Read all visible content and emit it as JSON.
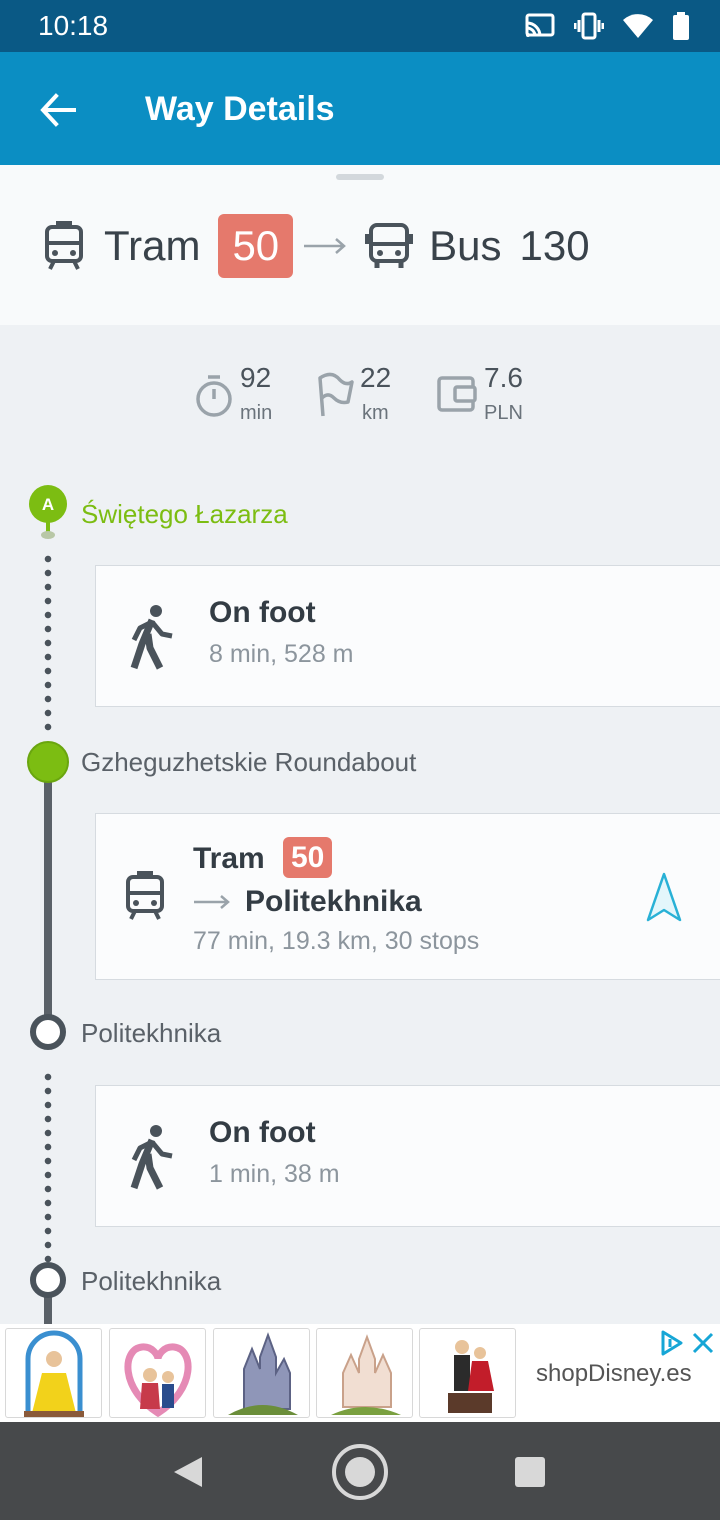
{
  "status_bar": {
    "time": "10:18"
  },
  "app_bar": {
    "title": "Way Details"
  },
  "summary": {
    "first_mode": "Tram",
    "first_line": "50",
    "second_mode": "Bus",
    "second_line": "130"
  },
  "stats": {
    "duration": {
      "value": "92",
      "unit": "min"
    },
    "distance": {
      "value": "22",
      "unit": "km"
    },
    "cost": {
      "value": "7.6",
      "unit": "PLN"
    }
  },
  "timeline": {
    "start_marker": "A",
    "stops": [
      "Świętego Łazarza",
      "Gzheguzhetskie Roundabout",
      "Politekhnika",
      "Politekhnika"
    ],
    "legs": [
      {
        "title": "On foot",
        "details": "8 min, 528 m"
      },
      {
        "mode": "Tram",
        "line": "50",
        "destination": "Politekhnika",
        "details": "77 min, 19.3 km, 30 stops"
      },
      {
        "title": "On foot",
        "details": "1 min, 38 m"
      }
    ]
  },
  "ad": {
    "brand": "shopDisney.es"
  },
  "colors": {
    "status_bar": "#0a5985",
    "app_bar": "#0b8ec3",
    "line_badge": "#e5796c",
    "start_green": "#7cbd12",
    "timeline": "#4a535b"
  }
}
